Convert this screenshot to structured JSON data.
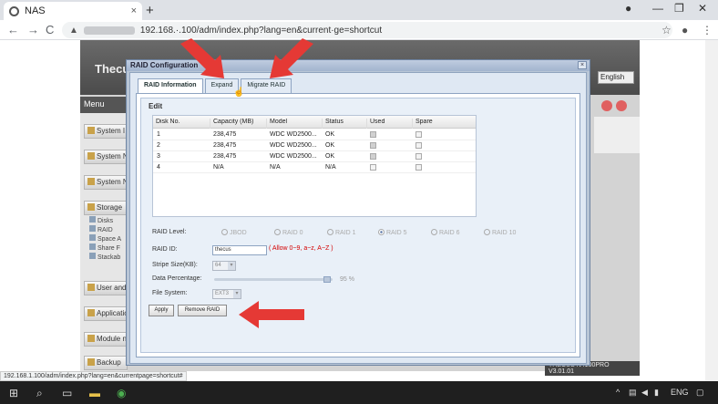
{
  "browser": {
    "tab_title": "NAS",
    "tab_close": "×",
    "new_tab": "+",
    "url": "192.168.·.100/adm/index.php?lang=en&current·ge=shortcut",
    "status_url": "192.168.1.100/adm/index.php?lang=en&currentpage=shortcut#",
    "back": "←",
    "forward": "→",
    "reload": "C",
    "warning": "▲",
    "star": "☆",
    "menu": "⋮"
  },
  "app": {
    "logo": "Thecus",
    "language": "English",
    "menu_label": "Menu",
    "footer": "THECUS N4100PRO V3.01.01",
    "sidebar": [
      {
        "label": "System I"
      },
      {
        "label": "System N"
      },
      {
        "label": "System N"
      },
      {
        "label": "Storage"
      },
      {
        "label": "User and"
      },
      {
        "label": "Applicatio"
      },
      {
        "label": "Module n"
      },
      {
        "label": "Backup"
      }
    ],
    "storage_sub": [
      {
        "label": "Disks"
      },
      {
        "label": "RAID"
      },
      {
        "label": "Space A"
      },
      {
        "label": "Share F"
      },
      {
        "label": "Stackab"
      }
    ]
  },
  "dialog": {
    "title": "RAID Configuration",
    "close": "×",
    "tabs": [
      {
        "label": "RAID Information",
        "active": true
      },
      {
        "label": "Expand",
        "active": false
      },
      {
        "label": "Migrate RAID",
        "active": false
      }
    ],
    "section": "Edit",
    "table": {
      "headers": [
        "Disk No.",
        "Capacity (MB)",
        "Model",
        "Status",
        "Used",
        "Spare"
      ],
      "rows": [
        {
          "disk": "1",
          "capacity": "238,475",
          "model": "WDC WD2500...",
          "status": "OK",
          "used": true
        },
        {
          "disk": "2",
          "capacity": "238,475",
          "model": "WDC WD2500...",
          "status": "OK",
          "used": true
        },
        {
          "disk": "3",
          "capacity": "238,475",
          "model": "WDC WD2500...",
          "status": "OK",
          "used": true
        },
        {
          "disk": "4",
          "capacity": "N/A",
          "model": "N/A",
          "status": "N/A",
          "used": false
        }
      ]
    },
    "form": {
      "raid_level_label": "RAID Level:",
      "raid_levels": [
        "JBOD",
        "RAID 0",
        "RAID 1",
        "RAID 5",
        "RAID 6",
        "RAID 10"
      ],
      "raid_level_selected": "RAID 5",
      "raid_id_label": "RAID ID:",
      "raid_id_value": "thecus",
      "raid_id_hint": "( Allow 0~9, a~z, A~Z )",
      "stripe_label": "Stripe Size(KB):",
      "stripe_value": "64",
      "data_pct_label": "Data Percentage:",
      "data_pct_value": "95 %",
      "data_pct_fraction": 0.95,
      "fs_label": "File System:",
      "fs_value": "EXT3",
      "apply": "Apply",
      "remove": "Remove RAID"
    }
  },
  "taskbar": {
    "start": "⊞",
    "search": "⌕",
    "lang": "ENG",
    "tray_up": "^"
  },
  "colors": {
    "annotation_arrow": "#e53935",
    "dialog_bg": "#dfe8f3",
    "hint": "#d40000"
  }
}
